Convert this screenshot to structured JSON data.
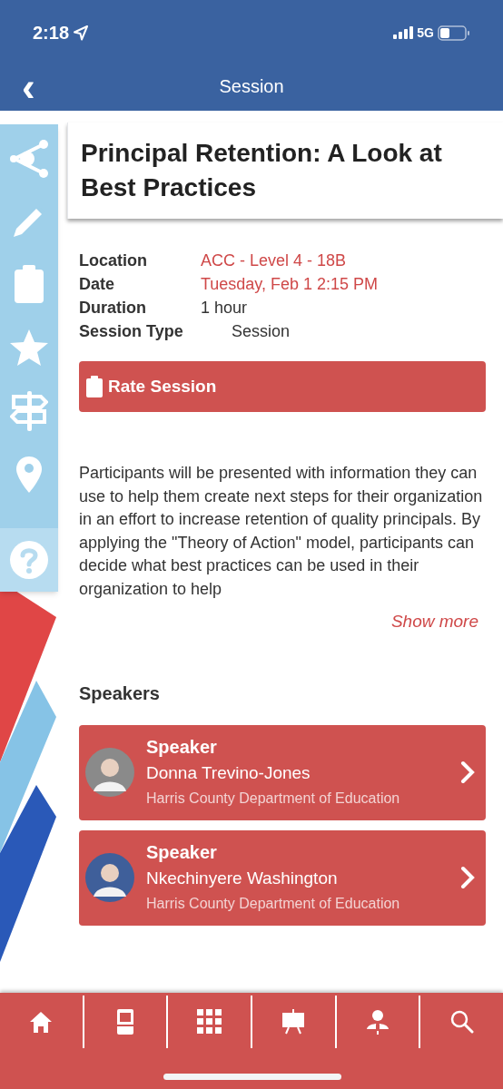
{
  "status_bar": {
    "time": "2:18",
    "network": "5G"
  },
  "nav": {
    "back": "‹",
    "title": "Session"
  },
  "session": {
    "title": "Principal Retention: A Look at Best Practices",
    "details": [
      {
        "label": "Location",
        "value": "ACC - Level 4 - 18B",
        "kind": "link"
      },
      {
        "label": "Date",
        "value": "Tuesday, Feb 1 2:15 PM",
        "kind": "link"
      },
      {
        "label": "Duration",
        "value": "1 hour",
        "kind": "text"
      },
      {
        "label": "Session Type",
        "value": "Session",
        "kind": "text"
      }
    ],
    "rate_button": "Rate Session",
    "description": "Participants will be presented with information they can use to help them create next steps for their organization in an effort to increase retention of quality principals. By applying the \"Theory of Action\" model, participants can decide what best practices can be used in their organization to help",
    "show_more": "Show more"
  },
  "speakers": {
    "heading": "Speakers",
    "items": [
      {
        "role": "Speaker",
        "name": "Donna Trevino-Jones",
        "organization": "Harris County Department of Education"
      },
      {
        "role": "Speaker",
        "name": "Nkechinyere Washington",
        "organization": "Harris County Department of Education"
      }
    ]
  }
}
